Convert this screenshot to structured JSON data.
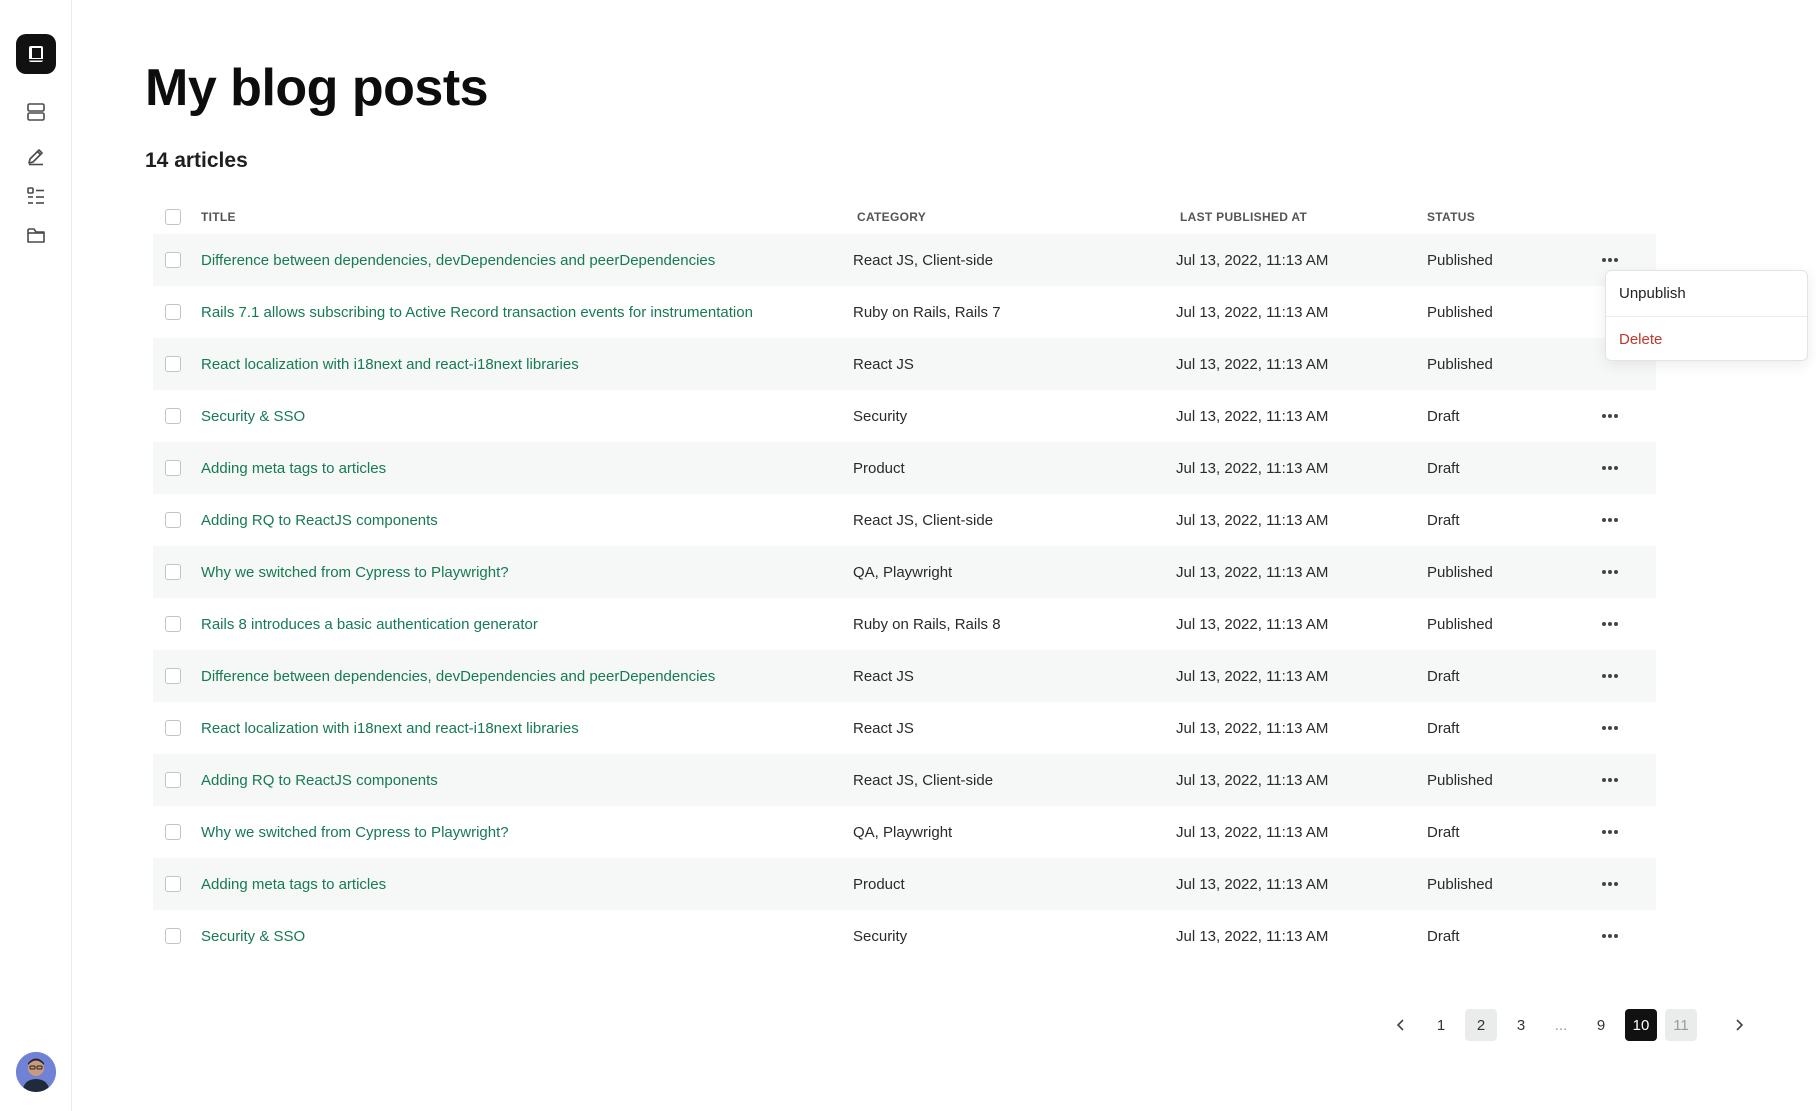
{
  "page": {
    "title": "My blog posts",
    "article_count": "14 articles"
  },
  "sidebar": {
    "icons": [
      "book-logo-icon",
      "stack-icon",
      "pencil-icon",
      "list-icon",
      "folder-icon"
    ]
  },
  "table": {
    "headers": {
      "title": "TITLE",
      "category": "CATEGORY",
      "last_published_at": "LAST PUBLISHED AT",
      "status": "STATUS"
    },
    "rows": [
      {
        "title": "Difference between dependencies, devDependencies and peerDependencies",
        "category": "React JS, Client-side",
        "date": "Jul 13, 2022, 11:13 AM",
        "status": "Published"
      },
      {
        "title": "Rails 7.1 allows subscribing to Active Record transaction events for instrumentation",
        "category": "Ruby on Rails,  Rails 7",
        "date": "Jul 13, 2022, 11:13 AM",
        "status": "Published"
      },
      {
        "title": "React localization with i18next and react-i18next libraries",
        "category": "React JS",
        "date": "Jul 13, 2022, 11:13 AM",
        "status": "Published"
      },
      {
        "title": "Security & SSO",
        "category": "Security",
        "date": "Jul 13, 2022, 11:13 AM",
        "status": "Draft"
      },
      {
        "title": "Adding meta tags to articles",
        "category": "Product",
        "date": "Jul 13, 2022, 11:13 AM",
        "status": "Draft"
      },
      {
        "title": "Adding RQ to ReactJS components",
        "category": "React JS, Client-side",
        "date": "Jul 13, 2022, 11:13 AM",
        "status": "Draft"
      },
      {
        "title": "Why we switched from Cypress to Playwright?",
        "category": "QA, Playwright",
        "date": "Jul 13, 2022, 11:13 AM",
        "status": "Published"
      },
      {
        "title": "Rails 8 introduces a basic authentication generator",
        "category": "Ruby on Rails,  Rails 8",
        "date": "Jul 13, 2022, 11:13 AM",
        "status": "Published"
      },
      {
        "title": "Difference between dependencies, devDependencies and peerDependencies",
        "category": "React JS",
        "date": "Jul 13, 2022, 11:13 AM",
        "status": "Draft"
      },
      {
        "title": "React localization with i18next and react-i18next libraries",
        "category": "React JS",
        "date": "Jul 13, 2022, 11:13 AM",
        "status": "Draft"
      },
      {
        "title": "Adding RQ to ReactJS components",
        "category": "React JS, Client-side",
        "date": "Jul 13, 2022, 11:13 AM",
        "status": "Published"
      },
      {
        "title": "Why we switched from Cypress to Playwright?",
        "category": "QA, Playwright",
        "date": "Jul 13, 2022, 11:13 AM",
        "status": "Draft"
      },
      {
        "title": "Adding meta tags to articles",
        "category": "Product",
        "date": "Jul 13, 2022, 11:13 AM",
        "status": "Published"
      },
      {
        "title": "Security & SSO",
        "category": "Security",
        "date": "Jul 13, 2022, 11:13 AM",
        "status": "Draft"
      }
    ]
  },
  "dropdown": {
    "unpublish": "Unpublish",
    "delete": "Delete"
  },
  "pagination": {
    "pages": [
      "1",
      "2",
      "3",
      "...",
      "9",
      "10",
      "11"
    ],
    "active": "10"
  },
  "colors": {
    "link": "#167a52",
    "delete": "#c0392b",
    "active_page": "#111111"
  }
}
